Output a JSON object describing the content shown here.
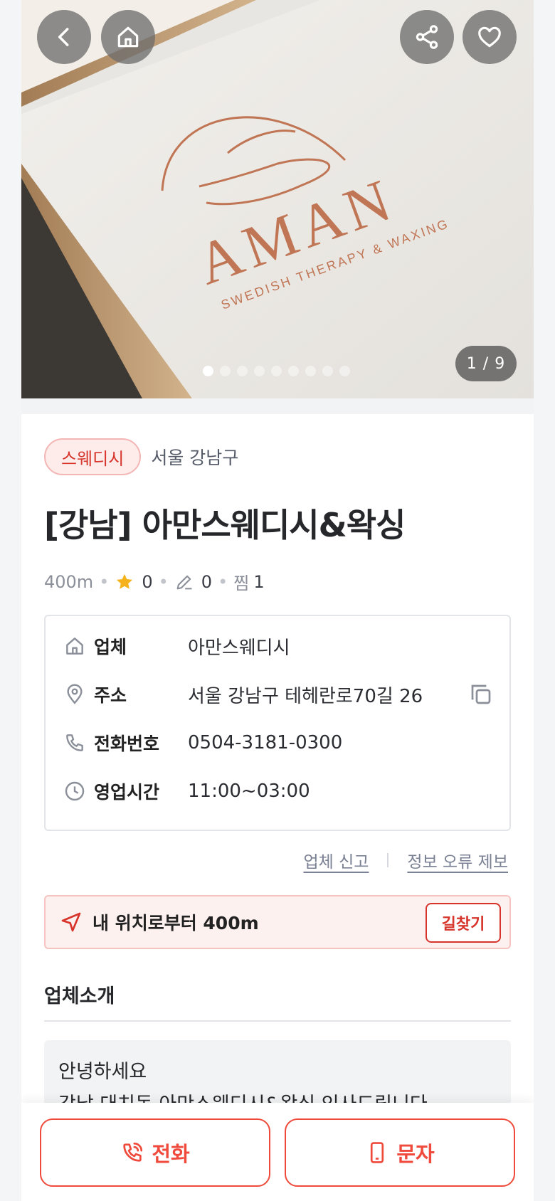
{
  "hero": {
    "logo_text": "AMAN",
    "logo_subtext": "SWEDISH THERAPY & WAXING",
    "counter": "1 / 9",
    "slide_count": 9,
    "active_slide": 0,
    "buttons": [
      "back-icon",
      "home-icon",
      "share-icon",
      "heart-icon"
    ]
  },
  "shop": {
    "category": "스웨디시",
    "region": "서울 강남구",
    "title": "[강남] 아만스웨디시&왁싱",
    "distance": "400m",
    "rating": "0",
    "reviews": "0",
    "wish_label": "찜",
    "wish_count": "1"
  },
  "info": {
    "rows": [
      {
        "label": "업체",
        "value": "아만스웨디시",
        "icon": "home-icon"
      },
      {
        "label": "주소",
        "value": "서울 강남구 테헤란로70길 26",
        "icon": "location-pin-icon"
      },
      {
        "label": "전화번호",
        "value": "0504-3181-0300",
        "icon": "phone-icon"
      },
      {
        "label": "영업시간",
        "value": "11:00~03:00",
        "icon": "clock-icon"
      }
    ]
  },
  "links": {
    "report": "업체 신고",
    "error_report": "정보 오류 제보"
  },
  "location": {
    "text": "내 위치로부터 400m",
    "route_button": "길찾기"
  },
  "intro": {
    "heading": "업체소개",
    "line1": "안녕하세요",
    "line2": "강남 대치동 아만스웨디시&왁싱 인사드립니다"
  },
  "bottom": {
    "call": "전화",
    "sms": "문자"
  },
  "colors": {
    "accent": "#ef4a3c",
    "chip_text": "#d7352c",
    "star": "#f6b21b"
  }
}
